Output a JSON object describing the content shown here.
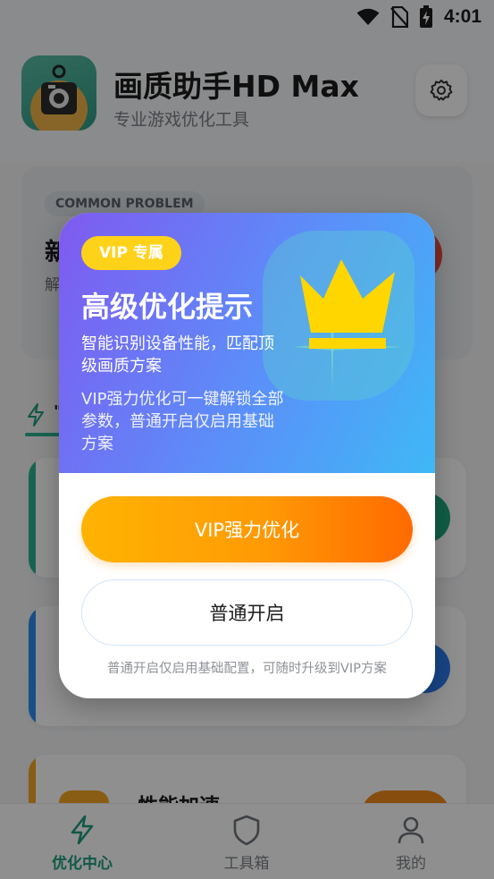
{
  "status_bar": {
    "time": "4:01",
    "icons": [
      "wifi-icon",
      "no-sim-icon",
      "battery-charging-icon"
    ]
  },
  "app": {
    "title": "画质助手HD Max",
    "subtitle": "专业游戏优化工具",
    "settings_icon": "gear-icon"
  },
  "problem_card": {
    "badge": "COMMON PROBLEM",
    "title_partial": "新",
    "desc_partial": "解"
  },
  "section": {
    "tab_icon": "lightning-icon",
    "tab_partial": "\""
  },
  "feature_card": {
    "title": "性能加速"
  },
  "bottom_nav": {
    "items": [
      {
        "label": "优化中心",
        "icon": "lightning-icon",
        "active": true
      },
      {
        "label": "工具箱",
        "icon": "shield-icon",
        "active": false
      },
      {
        "label": "我的",
        "icon": "user-icon",
        "active": false
      }
    ]
  },
  "dialog": {
    "tag": "VIP 专属",
    "title": "高级优化提示",
    "subtitle": "智能识别设备性能，匹配顶级画质方案",
    "description": "VIP强力优化可一键解锁全部参数，普通开启仅启用基础方案",
    "vip_button": "VIP强力优化",
    "normal_button": "普通开启",
    "note": "普通开启仅启用基础配置，可随时升级到VIP方案",
    "crown_icon": "crown-icon"
  },
  "colors": {
    "accent_green": "#1f9e7e",
    "hero_gradient_start": "#7f5af0",
    "hero_gradient_end": "#3fb8f5",
    "vip_tag": "#ffd21a",
    "vip_button_start": "#ffb302",
    "vip_button_end": "#ff6a00"
  }
}
